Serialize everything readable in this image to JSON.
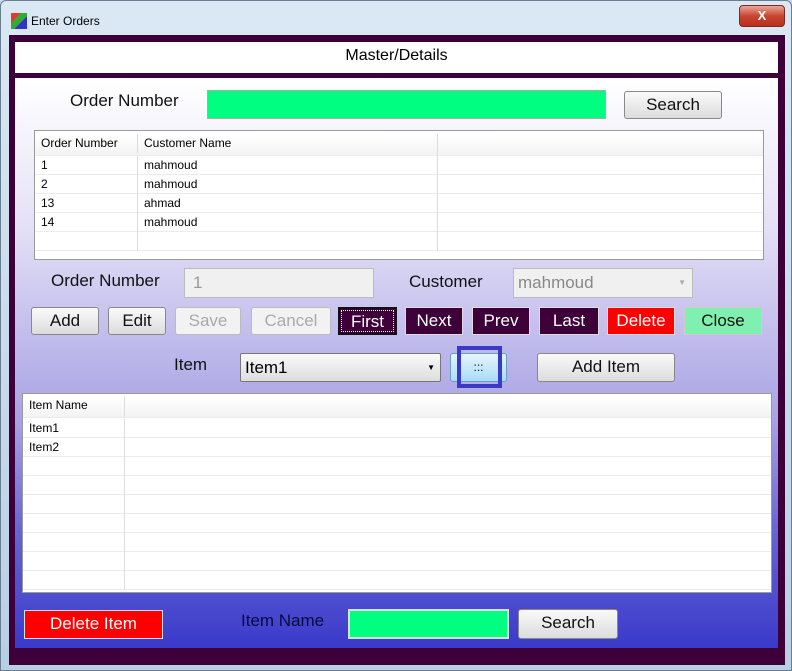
{
  "window": {
    "title": "Enter Orders",
    "close_label": "X"
  },
  "header": {
    "title": "Master/Details"
  },
  "search": {
    "label": "Order Number",
    "value": "",
    "button": "Search"
  },
  "orders_table": {
    "columns": [
      "Order Number",
      "Customer Name"
    ],
    "rows": [
      [
        "1",
        "mahmoud"
      ],
      [
        "2",
        "mahmoud"
      ],
      [
        "13",
        "ahmad"
      ],
      [
        "14",
        "mahmoud"
      ],
      [
        "",
        ""
      ]
    ]
  },
  "form": {
    "order_number_label": "Order Number",
    "order_number_value": "1",
    "customer_label": "Customer",
    "customer_value": "mahmoud"
  },
  "buttons": {
    "add": "Add",
    "edit": "Edit",
    "save": "Save",
    "cancel": "Cancel",
    "first": "First",
    "next": "Next",
    "prev": "Prev",
    "last": "Last",
    "delete": "Delete",
    "close": "Close"
  },
  "item": {
    "label": "Item",
    "value": "Item1",
    "browse": ":::",
    "add_item": "Add Item"
  },
  "items_table": {
    "columns": [
      "Item Name"
    ],
    "rows": [
      [
        "Item1"
      ],
      [
        "Item2"
      ],
      [
        ""
      ],
      [
        ""
      ],
      [
        ""
      ],
      [
        ""
      ],
      [
        ""
      ],
      [
        ""
      ],
      [
        ""
      ]
    ]
  },
  "bottom": {
    "delete_item": "Delete Item",
    "item_name_label": "Item Name",
    "item_name_value": "",
    "search": "Search"
  },
  "colors": {
    "frame": "#3d0038",
    "search_field": "#00ff80",
    "delete": "#ff0000",
    "close": "#80f0b0",
    "focus_border": "#3a3ac8"
  }
}
